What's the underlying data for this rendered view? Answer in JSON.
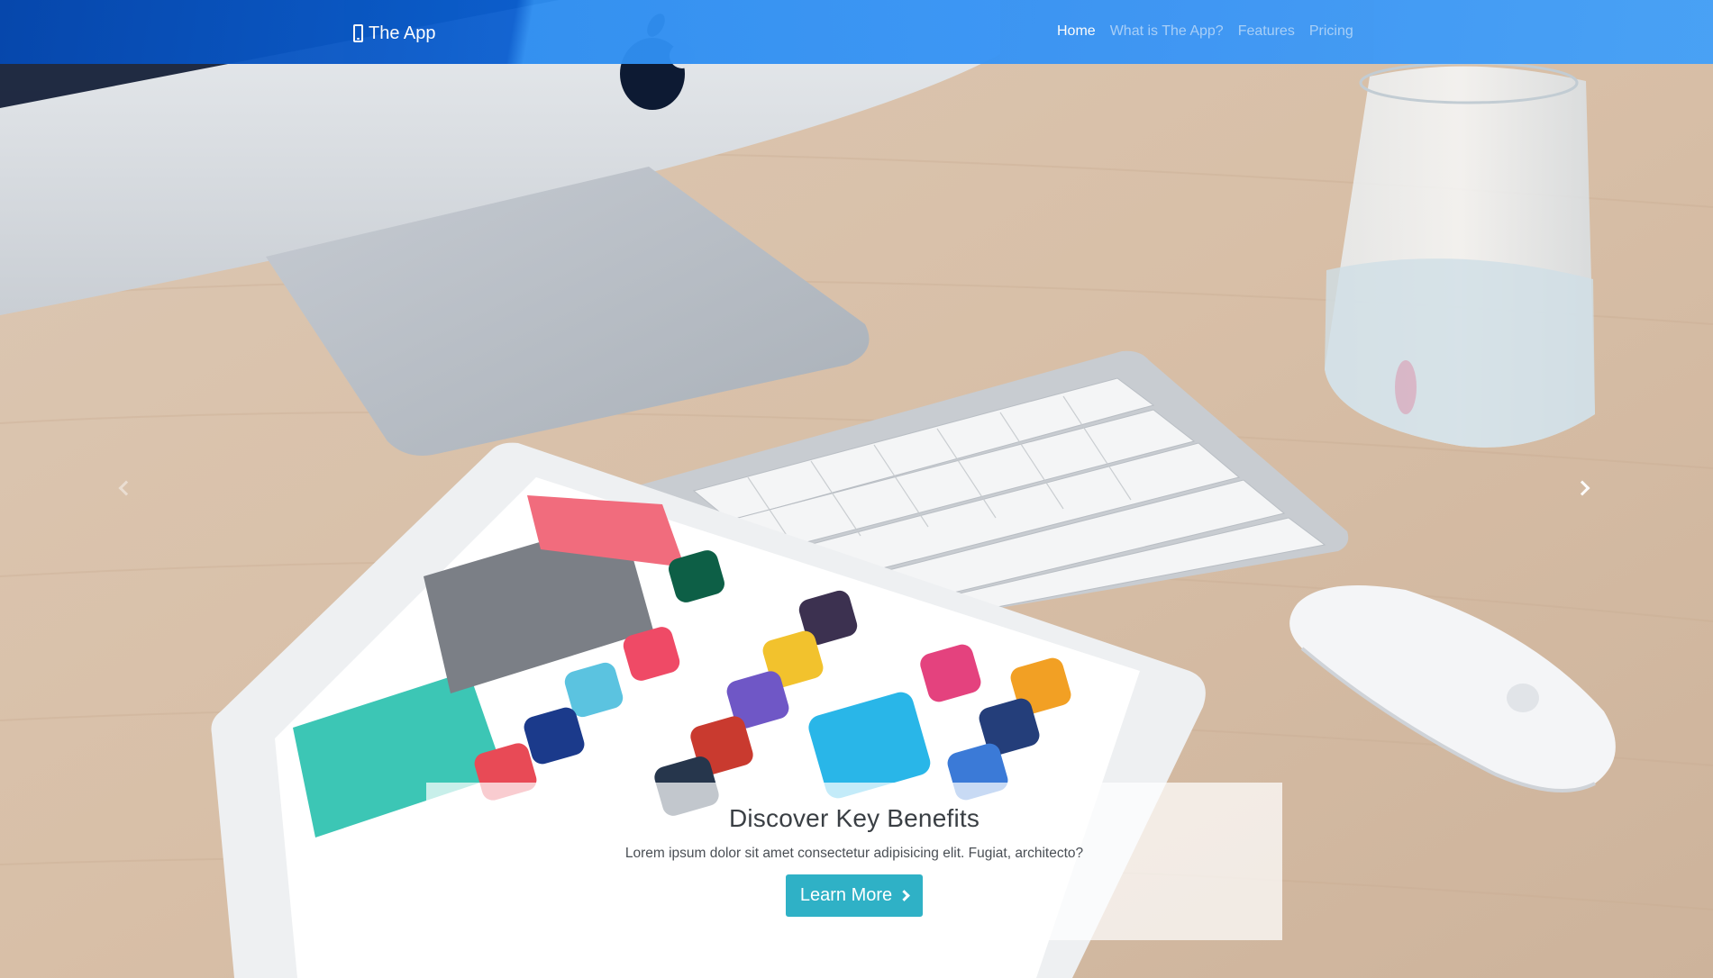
{
  "navbar": {
    "brand_icon": "mobile-phone-icon",
    "brand": "The App",
    "links": [
      {
        "label": "Home",
        "active": true
      },
      {
        "label": "What is The App?",
        "active": false
      },
      {
        "label": "Features",
        "active": false
      },
      {
        "label": "Pricing",
        "active": false
      }
    ]
  },
  "hero": {
    "title": "Discover Key Benefits",
    "text": "Lorem ipsum dolor sit amet consectetur adipisicing elit. Fugiat, architecto?",
    "button_label": "Learn More",
    "button_icon": "chevron-right-icon"
  },
  "carousel": {
    "prev_icon": "chevron-left-icon",
    "next_icon": "chevron-right-icon"
  },
  "colors": {
    "navbar_start": "#0548b0",
    "navbar_end": "#43a0f8",
    "button": "#2fb1c6"
  }
}
